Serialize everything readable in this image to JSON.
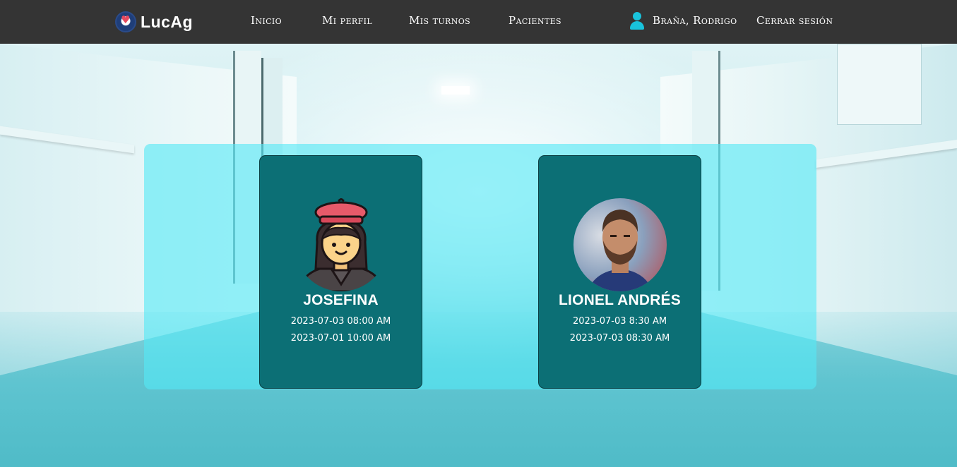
{
  "brand": {
    "name": "LucAg",
    "logo_icon": "heart-hands-logo"
  },
  "nav": {
    "items": [
      {
        "label": "Inicio"
      },
      {
        "label": "Mi perfil"
      },
      {
        "label": "Mis turnos"
      },
      {
        "label": "Pacientes"
      }
    ],
    "user_name": "Braña, Rodrigo",
    "logout_label": "Cerrar sesión"
  },
  "patients": [
    {
      "name": "JOSEFINA",
      "avatar": "woman-beret-avatar-icon",
      "appointments": [
        "2023-07-03 08:00 AM",
        "2023-07-01 10:00 AM"
      ]
    },
    {
      "name": "LIONEL ANDRÉS",
      "avatar": "profile-photo",
      "appointments": [
        "2023-07-03 8:30 AM",
        "2023-07-03 08:30 AM"
      ]
    }
  ],
  "colors": {
    "navbar": "#343434",
    "accent": "#19c3dc",
    "panel": "#56e8f5",
    "card": "#0c6f75"
  }
}
